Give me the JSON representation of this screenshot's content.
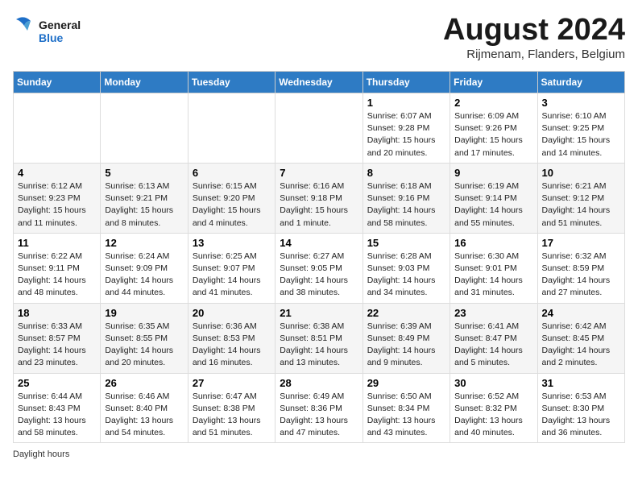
{
  "header": {
    "logo_general": "General",
    "logo_blue": "Blue",
    "month_year": "August 2024",
    "location": "Rijmenam, Flanders, Belgium"
  },
  "days_of_week": [
    "Sunday",
    "Monday",
    "Tuesday",
    "Wednesday",
    "Thursday",
    "Friday",
    "Saturday"
  ],
  "weeks": [
    [
      {
        "day": "",
        "info": ""
      },
      {
        "day": "",
        "info": ""
      },
      {
        "day": "",
        "info": ""
      },
      {
        "day": "",
        "info": ""
      },
      {
        "day": "1",
        "info": "Sunrise: 6:07 AM\nSunset: 9:28 PM\nDaylight: 15 hours\nand 20 minutes."
      },
      {
        "day": "2",
        "info": "Sunrise: 6:09 AM\nSunset: 9:26 PM\nDaylight: 15 hours\nand 17 minutes."
      },
      {
        "day": "3",
        "info": "Sunrise: 6:10 AM\nSunset: 9:25 PM\nDaylight: 15 hours\nand 14 minutes."
      }
    ],
    [
      {
        "day": "4",
        "info": "Sunrise: 6:12 AM\nSunset: 9:23 PM\nDaylight: 15 hours\nand 11 minutes."
      },
      {
        "day": "5",
        "info": "Sunrise: 6:13 AM\nSunset: 9:21 PM\nDaylight: 15 hours\nand 8 minutes."
      },
      {
        "day": "6",
        "info": "Sunrise: 6:15 AM\nSunset: 9:20 PM\nDaylight: 15 hours\nand 4 minutes."
      },
      {
        "day": "7",
        "info": "Sunrise: 6:16 AM\nSunset: 9:18 PM\nDaylight: 15 hours\nand 1 minute."
      },
      {
        "day": "8",
        "info": "Sunrise: 6:18 AM\nSunset: 9:16 PM\nDaylight: 14 hours\nand 58 minutes."
      },
      {
        "day": "9",
        "info": "Sunrise: 6:19 AM\nSunset: 9:14 PM\nDaylight: 14 hours\nand 55 minutes."
      },
      {
        "day": "10",
        "info": "Sunrise: 6:21 AM\nSunset: 9:12 PM\nDaylight: 14 hours\nand 51 minutes."
      }
    ],
    [
      {
        "day": "11",
        "info": "Sunrise: 6:22 AM\nSunset: 9:11 PM\nDaylight: 14 hours\nand 48 minutes."
      },
      {
        "day": "12",
        "info": "Sunrise: 6:24 AM\nSunset: 9:09 PM\nDaylight: 14 hours\nand 44 minutes."
      },
      {
        "day": "13",
        "info": "Sunrise: 6:25 AM\nSunset: 9:07 PM\nDaylight: 14 hours\nand 41 minutes."
      },
      {
        "day": "14",
        "info": "Sunrise: 6:27 AM\nSunset: 9:05 PM\nDaylight: 14 hours\nand 38 minutes."
      },
      {
        "day": "15",
        "info": "Sunrise: 6:28 AM\nSunset: 9:03 PM\nDaylight: 14 hours\nand 34 minutes."
      },
      {
        "day": "16",
        "info": "Sunrise: 6:30 AM\nSunset: 9:01 PM\nDaylight: 14 hours\nand 31 minutes."
      },
      {
        "day": "17",
        "info": "Sunrise: 6:32 AM\nSunset: 8:59 PM\nDaylight: 14 hours\nand 27 minutes."
      }
    ],
    [
      {
        "day": "18",
        "info": "Sunrise: 6:33 AM\nSunset: 8:57 PM\nDaylight: 14 hours\nand 23 minutes."
      },
      {
        "day": "19",
        "info": "Sunrise: 6:35 AM\nSunset: 8:55 PM\nDaylight: 14 hours\nand 20 minutes."
      },
      {
        "day": "20",
        "info": "Sunrise: 6:36 AM\nSunset: 8:53 PM\nDaylight: 14 hours\nand 16 minutes."
      },
      {
        "day": "21",
        "info": "Sunrise: 6:38 AM\nSunset: 8:51 PM\nDaylight: 14 hours\nand 13 minutes."
      },
      {
        "day": "22",
        "info": "Sunrise: 6:39 AM\nSunset: 8:49 PM\nDaylight: 14 hours\nand 9 minutes."
      },
      {
        "day": "23",
        "info": "Sunrise: 6:41 AM\nSunset: 8:47 PM\nDaylight: 14 hours\nand 5 minutes."
      },
      {
        "day": "24",
        "info": "Sunrise: 6:42 AM\nSunset: 8:45 PM\nDaylight: 14 hours\nand 2 minutes."
      }
    ],
    [
      {
        "day": "25",
        "info": "Sunrise: 6:44 AM\nSunset: 8:43 PM\nDaylight: 13 hours\nand 58 minutes."
      },
      {
        "day": "26",
        "info": "Sunrise: 6:46 AM\nSunset: 8:40 PM\nDaylight: 13 hours\nand 54 minutes."
      },
      {
        "day": "27",
        "info": "Sunrise: 6:47 AM\nSunset: 8:38 PM\nDaylight: 13 hours\nand 51 minutes."
      },
      {
        "day": "28",
        "info": "Sunrise: 6:49 AM\nSunset: 8:36 PM\nDaylight: 13 hours\nand 47 minutes."
      },
      {
        "day": "29",
        "info": "Sunrise: 6:50 AM\nSunset: 8:34 PM\nDaylight: 13 hours\nand 43 minutes."
      },
      {
        "day": "30",
        "info": "Sunrise: 6:52 AM\nSunset: 8:32 PM\nDaylight: 13 hours\nand 40 minutes."
      },
      {
        "day": "31",
        "info": "Sunrise: 6:53 AM\nSunset: 8:30 PM\nDaylight: 13 hours\nand 36 minutes."
      }
    ]
  ],
  "footer": {
    "daylight_label": "Daylight hours"
  }
}
